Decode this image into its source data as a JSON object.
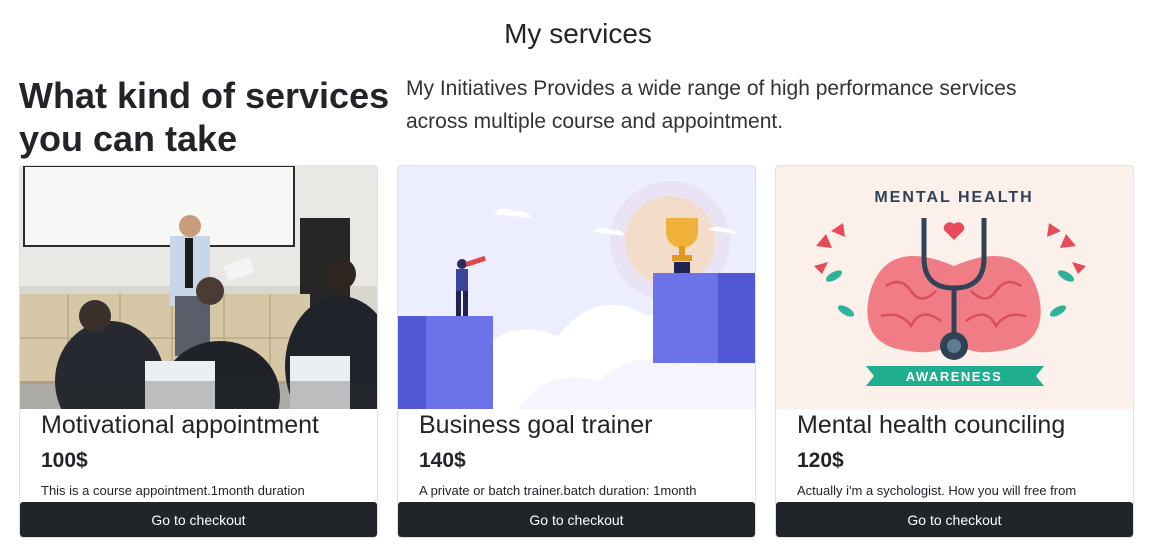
{
  "page": {
    "title": "My services"
  },
  "intro": {
    "heading": "What kind of services you can take",
    "text": "My Initiatives Provides a wide range of high performance services across multiple course and appointment."
  },
  "services": [
    {
      "image": "classroom-presentation-photo",
      "title": "Motivational appointment",
      "price": "100$",
      "description": "This is a course appointment.1month duration",
      "button_label": "Go to checkout"
    },
    {
      "image": "business-goal-illustration",
      "title": "Business goal trainer",
      "price": "140$",
      "description": "A private or batch trainer.batch duration: 1month",
      "button_label": "Go to checkout"
    },
    {
      "image": "mental-health-awareness-illustration",
      "image_text": {
        "top": "MENTAL HEALTH",
        "ribbon": "AWARENESS"
      },
      "title": "Mental health counciling",
      "price": "120$",
      "description": "Actually i'm a sychologist. How you will free from",
      "button_label": "Go to checkout"
    }
  ],
  "colors": {
    "button_bg": "#212529",
    "card_border": "#dfe1e4",
    "illustration_accent": "#6c72e8"
  }
}
